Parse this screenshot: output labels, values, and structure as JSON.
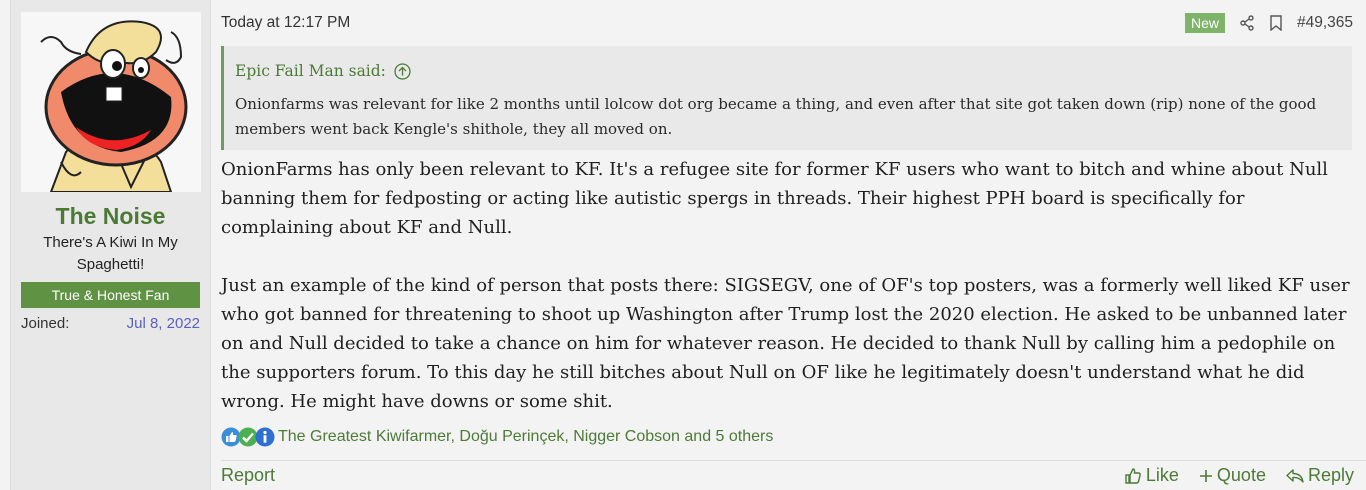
{
  "user": {
    "name": "The Noise",
    "title": "There's A Kiwi In My Spaghetti!",
    "banner": "True & Honest Fan",
    "joined_label": "Joined:",
    "joined_date": "Jul 8, 2022"
  },
  "post": {
    "timestamp": "Today at 12:17 PM",
    "new_badge": "New",
    "number": "#49,365",
    "quote": {
      "author_line": "Epic Fail Man said:",
      "text": "Onionfarms was relevant for like 2 months until lolcow dot org became a thing, and even after that site got taken down (rip) none of the good members went back Kengle's shithole, they all moved on."
    },
    "paragraphs": [
      "OnionFarms has only been relevant to KF. It's a refugee site for former KF users who want to bitch and whine about Null banning them for fedposting or acting like autistic spergs in threads. Their highest PPH board is specifically for complaining about KF and Null.",
      "Just an example of the kind of person that posts there: SIGSEGV, one of OF's top posters, was a formerly well liked KF user who got banned for threatening to shoot up Washington after Trump lost the 2020 election. He asked to be unbanned later on and Null decided to take a chance on him for whatever reason. He decided to thank Null by calling him a pedophile on the supporters forum. To this day he still bitches about Null on OF like he legitimately doesn't understand what he did wrong. He might have downs or some shit."
    ],
    "reactions_text": "The Greatest Kiwifarmer, Doğu Perinçek, Nigger Cobson and 5 others"
  },
  "footer": {
    "report": "Report",
    "like": "Like",
    "quote": "Quote",
    "reply": "Reply"
  },
  "colors": {
    "accent_green": "#4b7a35",
    "banner_green": "#5f9243",
    "new_badge": "#7fb36a",
    "joined_date": "#5a5fc0"
  }
}
